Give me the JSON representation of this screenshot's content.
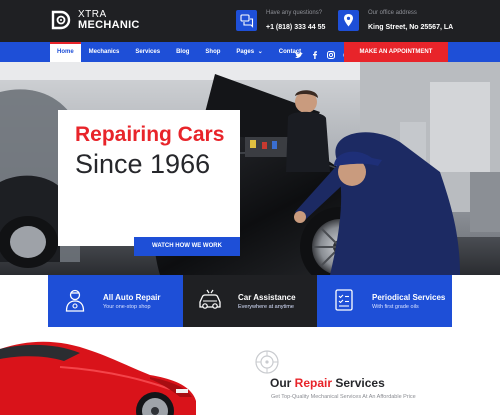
{
  "brand": {
    "line1": "XTRA",
    "line2": "MECHANIC"
  },
  "contacts": [
    {
      "label": "Have any questions?",
      "value": "+1 (818) 333 44 55",
      "icon": "chat-icon"
    },
    {
      "label": "Our office address",
      "value": "King Street, No 25567, LA",
      "icon": "location-pin-icon"
    }
  ],
  "nav": {
    "items": [
      "Home",
      "Mechanics",
      "Services",
      "Blog",
      "Shop",
      "Pages",
      "Contact"
    ],
    "dropdown_caret": "⌄",
    "social": [
      "twitter-icon",
      "facebook-icon",
      "instagram-icon",
      "skype-icon"
    ],
    "cta": "MAKE AN APPOINTMENT"
  },
  "hero": {
    "title_line1": "Repairing Cars",
    "title_line2": "Since 1966",
    "button": "WATCH HOW WE WORK"
  },
  "features": [
    {
      "title": "All Auto Repair",
      "subtitle": "Your one-stop shop",
      "icon": "mechanic-icon"
    },
    {
      "title": "Car Assistance",
      "subtitle": "Everywhere at anytime",
      "icon": "car-service-icon"
    },
    {
      "title": "Periodical Services",
      "subtitle": "With first grade oils",
      "icon": "checklist-icon"
    }
  ],
  "services": {
    "title_prefix": "Our ",
    "title_accent": "Repair",
    "title_suffix": " Services",
    "subtitle": "Get Top-Quality Mechanical Services At An Affordable Price"
  },
  "colors": {
    "blue": "#1e4fd7",
    "red": "#e8242a",
    "dark": "#1f2023"
  }
}
